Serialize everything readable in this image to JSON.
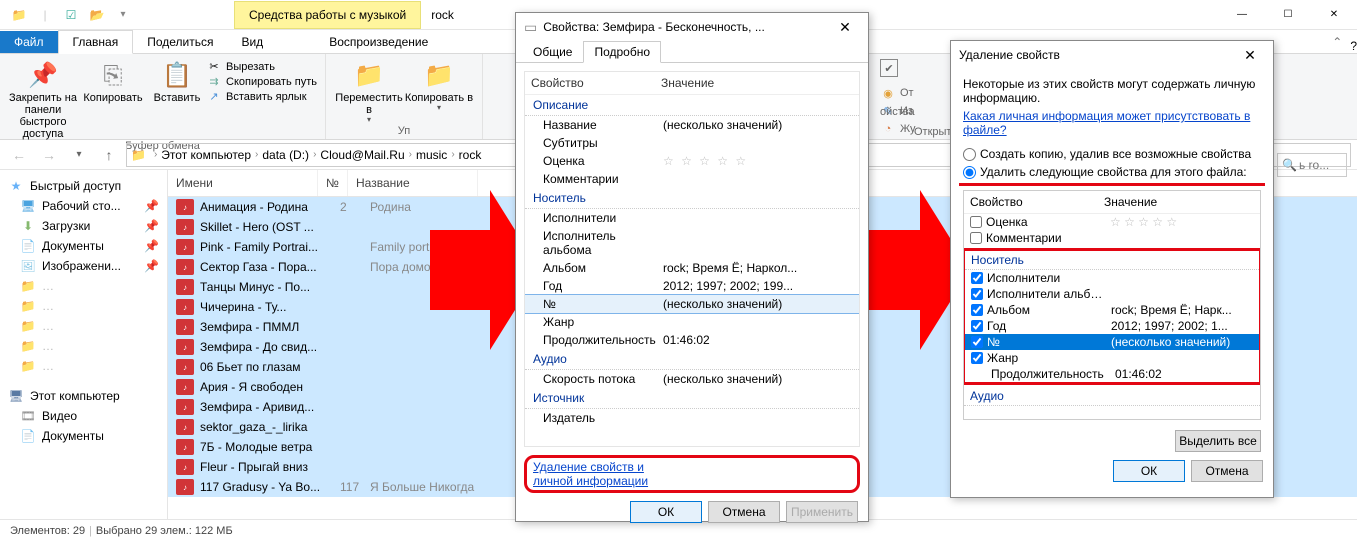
{
  "titlebar": {
    "context_tab": "Средства работы с музыкой",
    "folder_name": "rock"
  },
  "ribbon": {
    "tabs": {
      "file": "Файл",
      "home": "Главная",
      "share": "Поделиться",
      "view": "Вид",
      "playback": "Воспроизведение"
    },
    "pin": "Закрепить на панели\nбыстрого доступа",
    "copy": "Копировать",
    "paste": "Вставить",
    "cut": "Вырезать",
    "copy_path": "Скопировать путь",
    "paste_shortcut": "Вставить ярлык",
    "clipboard_group": "Буфер обмена",
    "move_to": "Переместить в",
    "copy_to": "Копировать в",
    "uporyad": "Уп",
    "open_group": "Открыт"
  },
  "rhs": {
    "ot": "От",
    "iz": "Из",
    "ju": "Жу",
    "svoistva": "ойства"
  },
  "breadcrumb": [
    "Этот компьютер",
    "data (D:)",
    "Cloud@Mail.Ru",
    "music",
    "rock"
  ],
  "search_placeholder": "ь ro...",
  "sidebar": {
    "quick": "Быстрый доступ",
    "desktop": "Рабочий сто...",
    "downloads": "Загрузки",
    "documents": "Документы",
    "pictures": "Изображени...",
    "this_pc": "Этот компьютер",
    "videos": "Видео",
    "docs2": "Документы"
  },
  "columns": {
    "name": "Имени",
    "no": "№",
    "title": "Название"
  },
  "files": [
    {
      "name": "Анимация - Родина",
      "no": "2",
      "title": "Родина"
    },
    {
      "name": "Skillet - Hero (OST ...",
      "no": "",
      "title": ""
    },
    {
      "name": "Pink - Family Portrai...",
      "no": "",
      "title": "Family portrait"
    },
    {
      "name": "Сектор Газа - Пора...",
      "no": "",
      "title": "Пора домой"
    },
    {
      "name": "Танцы Минус - По...",
      "no": "",
      "title": ""
    },
    {
      "name": "Чичерина - Ту...",
      "no": "",
      "title": ""
    },
    {
      "name": "Земфира - ПММЛ",
      "no": "",
      "title": ""
    },
    {
      "name": "Земфира - До свид...",
      "no": "",
      "title": ""
    },
    {
      "name": "06 Бьет по глазам",
      "no": "",
      "title": ""
    },
    {
      "name": "Ария - Я свободен",
      "no": "",
      "title": ""
    },
    {
      "name": "Земфира - Аривид...",
      "no": "",
      "title": ""
    },
    {
      "name": "sektor_gaza_-_lirika",
      "no": "",
      "title": ""
    },
    {
      "name": "7Б - Молодые ветра",
      "no": "",
      "title": ""
    },
    {
      "name": "Fleur - Прыгай вниз",
      "no": "",
      "title": ""
    },
    {
      "name": "117 Gradusy - Ya Bo...",
      "no": "117",
      "title": "Я Больше Никогда"
    }
  ],
  "statusbar": {
    "elements": "Элементов: 29",
    "selected": "Выбрано 29 элем.: 122 МБ"
  },
  "props_dialog": {
    "title": "Свойства: Земфира - Бесконечность, ...",
    "tabs": {
      "general": "Общие",
      "details": "Подробно"
    },
    "col_property": "Свойство",
    "col_value": "Значение",
    "sections": {
      "description": "Описание",
      "media": "Носитель",
      "audio": "Аудио",
      "source": "Источник"
    },
    "rows": {
      "name": {
        "label": "Название",
        "value": "(несколько значений)"
      },
      "subtitles": {
        "label": "Субтитры",
        "value": ""
      },
      "rating": {
        "label": "Оценка",
        "value": "☆ ☆ ☆ ☆ ☆"
      },
      "comments": {
        "label": "Комментарии",
        "value": ""
      },
      "artists": {
        "label": "Исполнители",
        "value": ""
      },
      "album_artist": {
        "label": "Исполнитель альбома",
        "value": ""
      },
      "album": {
        "label": "Альбом",
        "value": "rock; Время Ё; Наркол..."
      },
      "year": {
        "label": "Год",
        "value": "2012; 1997; 2002; 199..."
      },
      "no": {
        "label": "№",
        "value": "(несколько значений)"
      },
      "genre": {
        "label": "Жанр",
        "value": ""
      },
      "duration": {
        "label": "Продолжительность",
        "value": "01:46:02"
      },
      "bitrate": {
        "label": "Скорость потока",
        "value": "(несколько значений)"
      },
      "publisher": {
        "label": "Издатель",
        "value": ""
      }
    },
    "remove_link": "Удаление свойств и личной информации",
    "ok": "ОК",
    "cancel": "Отмена",
    "apply": "Применить"
  },
  "remove_dialog": {
    "title": "Удаление свойств",
    "intro": "Некоторые из этих свойств могут содержать личную информацию.",
    "help_link": "Какая личная информация может присутствовать в файле?",
    "opt1": "Создать копию, удалив все возможные свойства",
    "opt2": "Удалить следующие свойства для этого файла:",
    "col_property": "Свойство",
    "col_value": "Значение",
    "rows": {
      "rating": {
        "label": "Оценка",
        "value": "☆ ☆ ☆ ☆ ☆",
        "checked": false
      },
      "comments": {
        "label": "Комментарии",
        "value": "",
        "checked": false
      },
      "section_media": "Носитель",
      "artists": {
        "label": "Исполнители",
        "value": "",
        "checked": true
      },
      "album_artist": {
        "label": "Исполнители альбома",
        "value": "",
        "checked": true
      },
      "album": {
        "label": "Альбом",
        "value": "rock; Время Ё; Нарк...",
        "checked": true
      },
      "year": {
        "label": "Год",
        "value": "2012; 1997; 2002; 1...",
        "checked": true
      },
      "no": {
        "label": "№",
        "value": "(несколько значений)",
        "checked": true
      },
      "genre": {
        "label": "Жанр",
        "value": "",
        "checked": true
      },
      "duration": {
        "label": "Продолжительность",
        "value": "01:46:02",
        "checked": false
      },
      "section_audio": "Аудио"
    },
    "select_all": "Выделить все",
    "ok": "ОК",
    "cancel": "Отмена"
  }
}
